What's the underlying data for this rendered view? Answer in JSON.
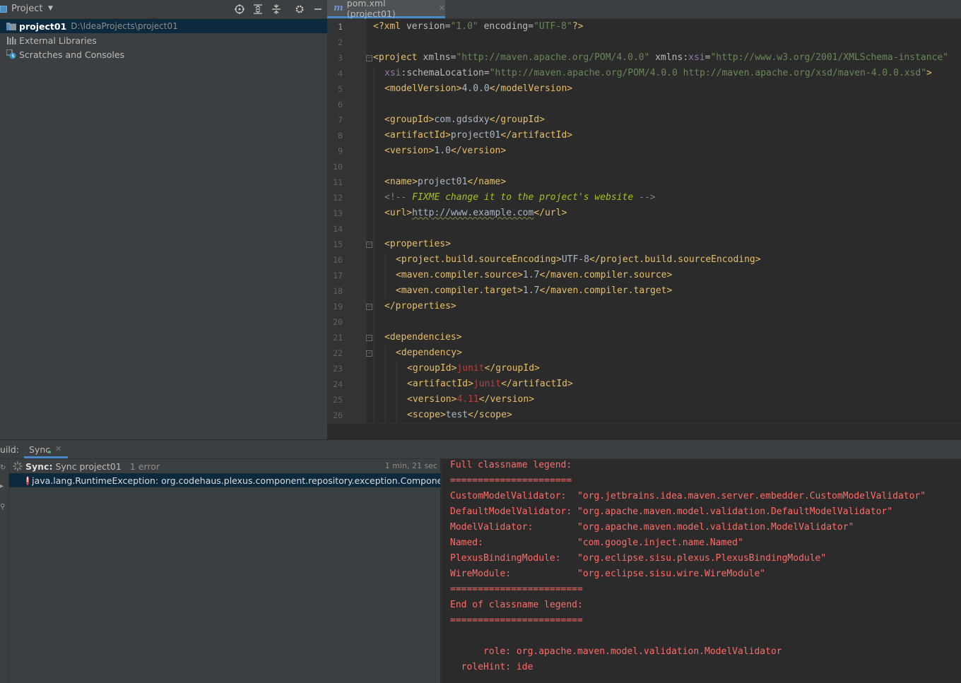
{
  "project_panel": {
    "title": "Project",
    "tree": [
      {
        "name": "project01",
        "path": "D:\\IdeaProjects\\project01"
      },
      {
        "name": "External Libraries"
      },
      {
        "name": "Scratches and Consoles"
      }
    ]
  },
  "editor": {
    "tab_icon": "m",
    "tab_label": "pom.xml (project01)",
    "line_numbers": [
      "1",
      "2",
      "3",
      "4",
      "5",
      "6",
      "7",
      "8",
      "9",
      "10",
      "11",
      "12",
      "13",
      "14",
      "15",
      "16",
      "17",
      "18",
      "19",
      "20",
      "21",
      "22",
      "23",
      "24",
      "25",
      "26"
    ],
    "code": {
      "l1": {
        "a": "<?xml ",
        "b": "version",
        "c": "=",
        "d": "\"1.0\"",
        "e": " ",
        "f": "encoding",
        "g": "=",
        "h": "\"UTF-8\"",
        "i": "?>"
      },
      "l3": {
        "a": "<project ",
        "b": "xmlns",
        "c": "=",
        "d": "\"http://maven.apache.org/POM/4.0.0\"",
        "e": " xmlns:",
        "f": "xsi",
        "g": "=",
        "h": "\"http://www.w3.org/2001/XMLSchema-instance\""
      },
      "l4": {
        "a": "xsi",
        ":": ":",
        "b": "schemaLocation",
        "c": "=",
        "d": "\"http://maven.apache.org/POM/4.0.0 http://maven.apache.org/xsd/maven-4.0.0.xsd\"",
        "e": ">"
      },
      "l5": {
        "o": "<modelVersion>",
        "v": "4.0.0",
        "c": "</modelVersion>"
      },
      "l7": {
        "o": "<groupId>",
        "v": "com.gdsdxy",
        "c": "</groupId>"
      },
      "l8": {
        "o": "<artifactId>",
        "v": "project01",
        "c": "</artifactId>"
      },
      "l9": {
        "o": "<version>",
        "v": "1.0",
        "c": "</version>"
      },
      "l11": {
        "o": "<name>",
        "v": "project01",
        "c": "</name>"
      },
      "l12": {
        "o": "<!-- ",
        "v": "FIXME change it to the project's website",
        "c": " -->"
      },
      "l13": {
        "o": "<url>",
        "v": "http://www.example.com",
        "c": "</url>"
      },
      "l15": {
        "o": "<properties>"
      },
      "l16": {
        "o": "<project.build.sourceEncoding>",
        "v": "UTF-8",
        "c": "</project.build.sourceEncoding>"
      },
      "l17": {
        "o": "<maven.compiler.source>",
        "v": "1.7",
        "c": "</maven.compiler.source>"
      },
      "l18": {
        "o": "<maven.compiler.target>",
        "v": "1.7",
        "c": "</maven.compiler.target>"
      },
      "l19": {
        "o": "</properties>"
      },
      "l21": {
        "o": "<dependencies>"
      },
      "l22": {
        "o": "<dependency>"
      },
      "l23": {
        "o": "<groupId>",
        "v": "junit",
        "c": "</groupId>"
      },
      "l24": {
        "o": "<artifactId>",
        "v": "junit",
        "c": "</artifactId>"
      },
      "l25": {
        "o": "<version>",
        "v": "4.11",
        "c": "</version>"
      },
      "l26": {
        "o": "<scope>",
        "v": "test",
        "c": "</scope>"
      }
    }
  },
  "build": {
    "label": "uild:",
    "tab_label": "Sync",
    "sync_row": {
      "bold": "Sync:",
      "text": " Sync project01",
      "errors": "1 error",
      "time": "1 min, 21 sec"
    },
    "error_row": "java.lang.RuntimeException: org.codehaus.plexus.component.repository.exception.ComponentLookupException",
    "console": [
      "Full classname legend:",
      "======================",
      "CustomModelValidator:  \"org.jetbrains.idea.maven.server.embedder.CustomModelValidator\"",
      "DefaultModelValidator: \"org.apache.maven.model.validation.DefaultModelValidator\"",
      "ModelValidator:        \"org.apache.maven.model.validation.ModelValidator\"",
      "Named:                 \"com.google.inject.name.Named\"",
      "PlexusBindingModule:   \"org.eclipse.sisu.plexus.PlexusBindingModule\"",
      "WireModule:            \"org.eclipse.sisu.wire.WireModule\"",
      "========================",
      "End of classname legend:",
      "========================",
      "",
      "      role: org.apache.maven.model.validation.ModelValidator",
      "  roleHint: ide"
    ]
  }
}
